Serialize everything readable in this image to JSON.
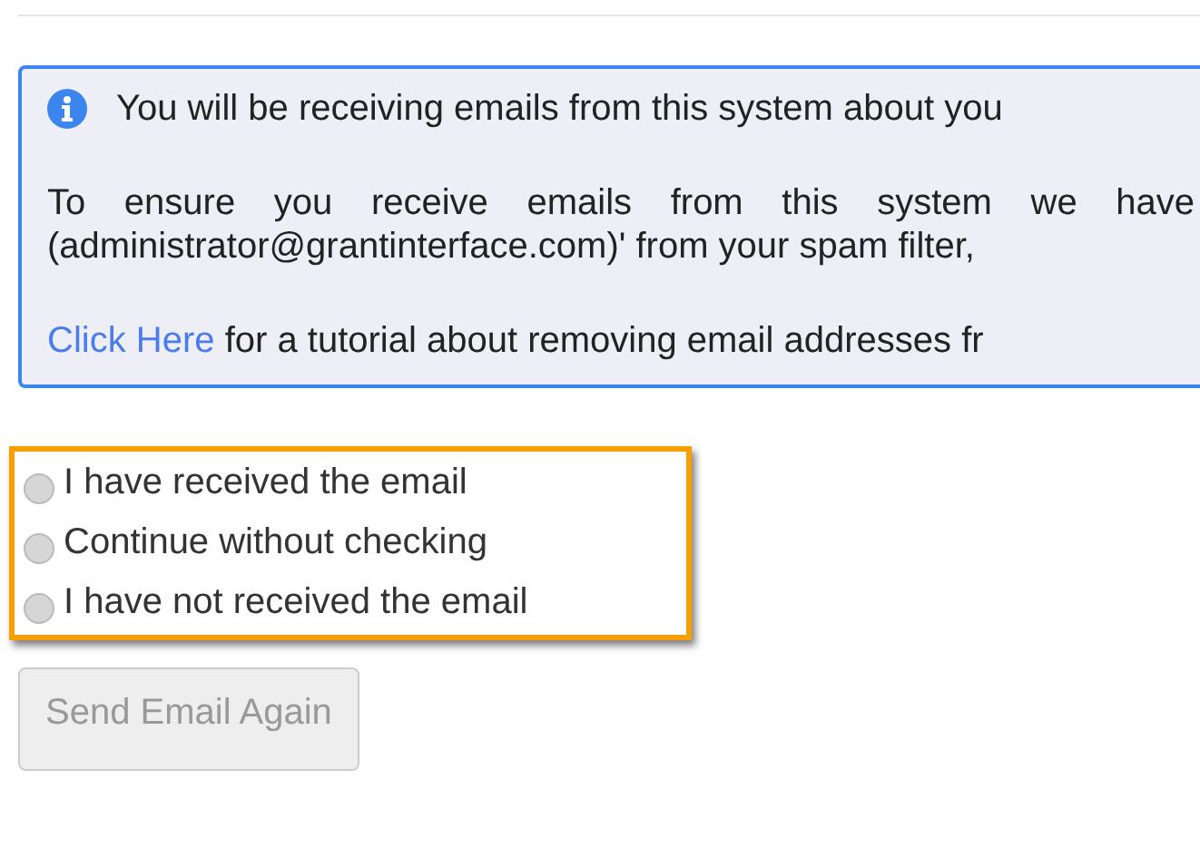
{
  "notice": {
    "intro": "You will be receiving emails from this system about you",
    "spam_line_1": "To ensure you receive emails from this system we have",
    "spam_line_2": "(administrator@grantinterface.com)' from your spam filter,",
    "link": "Click Here",
    "tutorial": "for a tutorial about removing email addresses fr"
  },
  "options": [
    {
      "label": "I have received the email",
      "selected": false
    },
    {
      "label": "Continue without checking",
      "selected": false
    },
    {
      "label": "I have not received the email",
      "selected": false
    }
  ],
  "button": {
    "label": "Send Email Again",
    "disabled": true
  }
}
